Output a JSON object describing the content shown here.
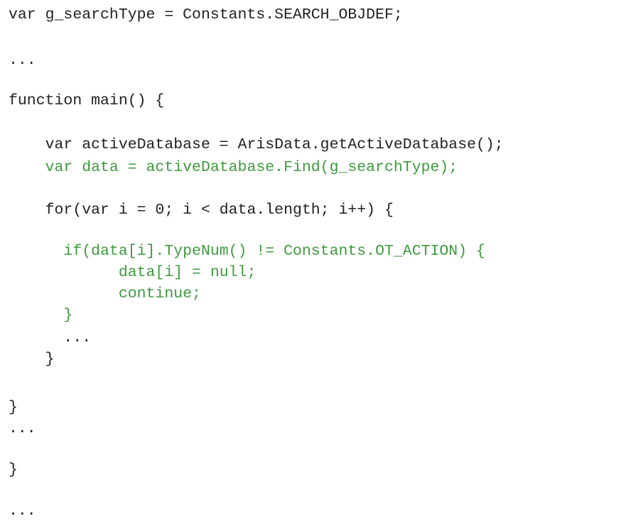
{
  "code": {
    "lines": [
      "var g_searchType = Constants.SEARCH_OBJDEF;",
      "...",
      "function main() {",
      "    var activeDatabase = ArisData.getActiveDatabase();",
      "    var data = activeDatabase.Find(g_searchType);",
      "    for(var i = 0; i < data.length; i++) {",
      "      if(data[i].TypeNum() != Constants.OT_ACTION) {",
      "            data[i] = null;",
      "            continue;",
      "      }",
      "      ...",
      "    }",
      "}",
      "...",
      "}",
      "..."
    ]
  },
  "colors": {
    "default_text": "#222222",
    "highlight_text": "#3e9a3e",
    "background": "#ffffff"
  }
}
